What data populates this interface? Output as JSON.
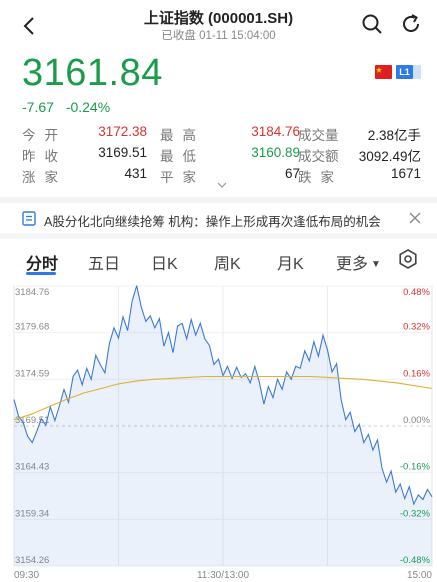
{
  "header": {
    "title": "上证指数 (000001.SH)",
    "subtitle": "已收盘  01-11 15:04:00"
  },
  "quote": {
    "price": "3161.84",
    "change": "-7.67",
    "change_pct": "-0.24%",
    "badge": "L1"
  },
  "stats": {
    "rows": [
      [
        {
          "label": "今开",
          "value": "3172.38",
          "color": "red"
        },
        {
          "label": "最高",
          "value": "3184.76",
          "color": "red"
        },
        {
          "label": "成交量",
          "value": "2.38亿手",
          "color": "dark"
        }
      ],
      [
        {
          "label": "昨收",
          "value": "3169.51",
          "color": "dark"
        },
        {
          "label": "最低",
          "value": "3160.89",
          "color": "green"
        },
        {
          "label": "成交额",
          "value": "3092.49亿",
          "color": "dark"
        }
      ],
      [
        {
          "label": "涨家",
          "value": "431",
          "color": "dark"
        },
        {
          "label": "平家",
          "value": "67",
          "color": "dark"
        },
        {
          "label": "跌家",
          "value": "1671",
          "color": "dark"
        }
      ]
    ]
  },
  "news": {
    "text": "A股分化北向继续抢筹 机构：操作上形成再次逢低布局的机会"
  },
  "tabs": [
    "分时",
    "五日",
    "日K",
    "周K",
    "月K",
    "更多"
  ],
  "active_tab": 0,
  "colors": {
    "down": "#1a9c4a",
    "up": "#e03030",
    "accent": "#2f7ae5",
    "price_line": "#3c78d8",
    "avg_line": "#e0b030"
  },
  "chart_data": {
    "type": "line",
    "x_ticks": [
      "09:30",
      "11:30/13:00",
      "15:00"
    ],
    "y_ticks_left": [
      "3184.76",
      "3179.68",
      "3174.59",
      "3169.51",
      "3164.43",
      "3159.34",
      "3154.26"
    ],
    "y_ticks_right": [
      "0.48%",
      "0.32%",
      "0.16%",
      "0.00%",
      "-0.16%",
      "-0.32%",
      "-0.48%"
    ],
    "ylim": [
      3154.26,
      3184.76
    ],
    "prev_close": 3169.51,
    "series": [
      {
        "key": "price",
        "values": [
          3172.4,
          3170.6,
          3169.9,
          3168.4,
          3167.7,
          3168.9,
          3170.3,
          3169.6,
          3171.6,
          3170.1,
          3171.7,
          3173.5,
          3172.1,
          3174.9,
          3175.6,
          3174.0,
          3175.8,
          3174.6,
          3177.2,
          3176.2,
          3175.3,
          3178.5,
          3180.2,
          3179.1,
          3181.4,
          3179.9,
          3183.1,
          3184.8,
          3182.5,
          3180.9,
          3181.5,
          3180.2,
          3181.2,
          3178.2,
          3179.7,
          3177.5,
          3180.4,
          3180.7,
          3179.0,
          3181.1,
          3179.4,
          3180.7,
          3179.0,
          3178.3,
          3176.2,
          3176.8,
          3175.0,
          3176.0,
          3174.7,
          3175.9,
          3174.8,
          3175.2,
          3174.2,
          3176.0,
          3174.3,
          3171.9,
          3173.8,
          3172.6,
          3174.6,
          3173.5,
          3175.4,
          3174.6,
          3176.0,
          3175.8,
          3177.7,
          3176.6,
          3178.7,
          3177.1,
          3179.4,
          3177.8,
          3175.4,
          3176.3,
          3172.4,
          3170.2,
          3171.0,
          3168.9,
          3169.7,
          3167.7,
          3168.6,
          3166.9,
          3168.0,
          3164.9,
          3163.4,
          3164.6,
          3162.3,
          3163.2,
          3161.6,
          3162.9,
          3161.0,
          3162.0,
          3161.5,
          3162.6,
          3161.8
        ],
        "wiggle": 0.0
      },
      {
        "key": "avg",
        "values": [
          3170.2,
          3170.8,
          3171.6,
          3172.4,
          3173.1,
          3173.6,
          3174.1,
          3174.4,
          3174.6,
          3174.7,
          3174.8,
          3174.9,
          3174.9,
          3174.9,
          3174.9,
          3174.9,
          3174.9,
          3174.9,
          3174.8,
          3174.7,
          3174.6,
          3174.4,
          3174.2,
          3173.9,
          3173.6
        ]
      }
    ]
  }
}
